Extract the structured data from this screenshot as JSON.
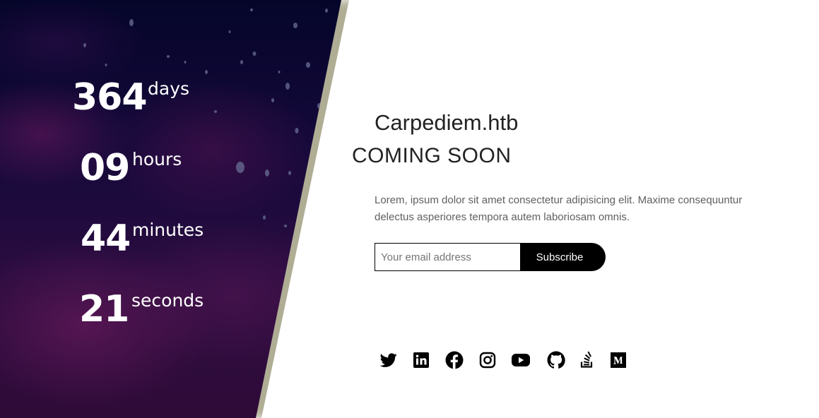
{
  "countdown": {
    "days": {
      "value": "364",
      "unit": "days"
    },
    "hours": {
      "value": "09",
      "unit": "hours"
    },
    "minutes": {
      "value": "44",
      "unit": "minutes"
    },
    "seconds": {
      "value": "21",
      "unit": "seconds"
    }
  },
  "main": {
    "site_title": "Carpediem.htb",
    "headline": "COMING SOON",
    "description": "Lorem, ipsum dolor sit amet consectetur adipisicing elit. Maxime consequuntur delectus asperiores tempora autem laboriosam omnis."
  },
  "subscribe": {
    "placeholder": "Your email address",
    "value": "",
    "button_label": "Subscribe"
  },
  "social_icons": [
    "twitter-icon",
    "linkedin-icon",
    "facebook-icon",
    "instagram-icon",
    "youtube-icon",
    "github-icon",
    "stackoverflow-icon",
    "medium-icon"
  ],
  "colors": {
    "panel_dark": "#05052a",
    "panel_purple": "#2f0b38",
    "button": "#000000",
    "text_dark": "#222222"
  }
}
